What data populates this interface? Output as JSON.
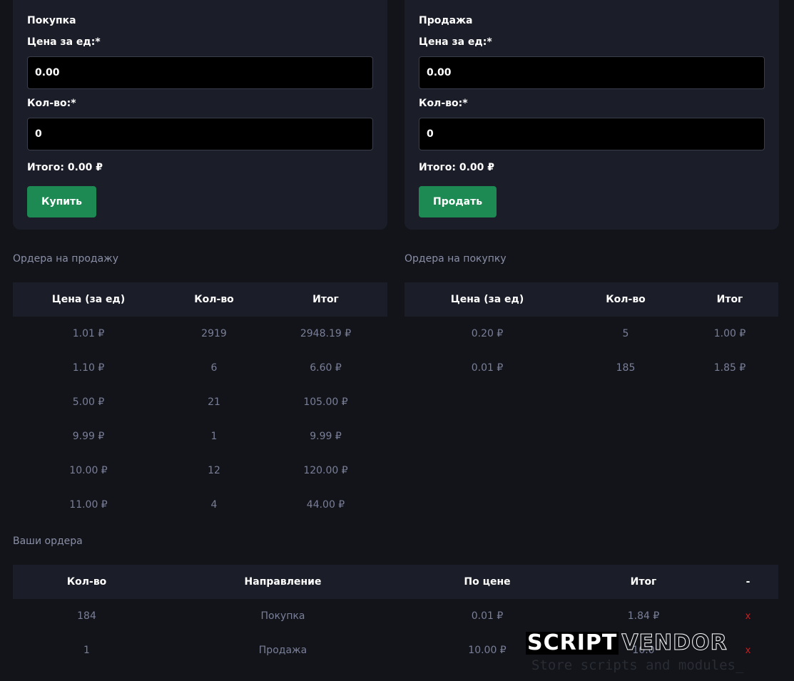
{
  "buy_panel": {
    "title": "Покупка",
    "price_label": "Цена за ед:*",
    "price_value": "0.00",
    "qty_label": "Кол-во:*",
    "qty_value": "0",
    "total": "Итого: 0.00 ₽",
    "button": "Купить"
  },
  "sell_panel": {
    "title": "Продажа",
    "price_label": "Цена за ед:*",
    "price_value": "0.00",
    "qty_label": "Кол-во:*",
    "qty_value": "0",
    "total": "Итого: 0.00 ₽",
    "button": "Продать"
  },
  "sell_orders": {
    "title": "Ордера на продажу",
    "headers": [
      "Цена (за ед)",
      "Кол-во",
      "Итог"
    ],
    "rows": [
      [
        "1.01 ₽",
        "2919",
        "2948.19 ₽"
      ],
      [
        "1.10 ₽",
        "6",
        "6.60 ₽"
      ],
      [
        "5.00 ₽",
        "21",
        "105.00 ₽"
      ],
      [
        "9.99 ₽",
        "1",
        "9.99 ₽"
      ],
      [
        "10.00 ₽",
        "12",
        "120.00 ₽"
      ],
      [
        "11.00 ₽",
        "4",
        "44.00 ₽"
      ]
    ]
  },
  "buy_orders": {
    "title": "Ордера на покупку",
    "headers": [
      "Цена (за ед)",
      "Кол-во",
      "Итог"
    ],
    "rows": [
      [
        "0.20 ₽",
        "5",
        "1.00 ₽"
      ],
      [
        "0.01 ₽",
        "185",
        "1.85 ₽"
      ]
    ]
  },
  "my_orders": {
    "title": "Ваши ордера",
    "headers": [
      "Кол-во",
      "Направление",
      "По цене",
      "Итог",
      "-"
    ],
    "rows": [
      [
        "184",
        "Покупка",
        "0.01 ₽",
        "1.84 ₽",
        "x"
      ],
      [
        "1",
        "Продажа",
        "10.00 ₽",
        "10.0",
        "x"
      ]
    ]
  },
  "watermark": {
    "brand_part1": "SCRIPT",
    "brand_part2": "VENDOR",
    "tagline": "Store scripts and modules_"
  }
}
